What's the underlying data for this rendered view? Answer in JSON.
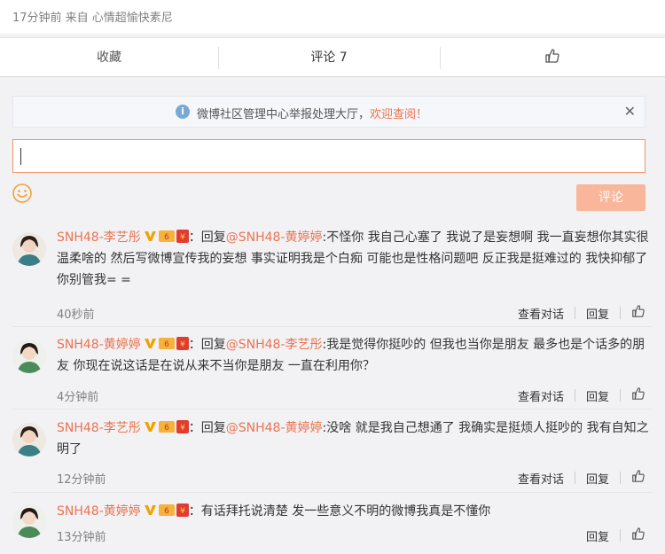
{
  "post": {
    "meta": "17分钟前 来自 心情超愉快素尼"
  },
  "tabs": [
    {
      "label": "收藏"
    },
    {
      "label": "评论 7"
    }
  ],
  "notice": {
    "text": "微博社区管理中心举报处理大厅，",
    "link": "欢迎查阅！"
  },
  "input": {
    "value": ""
  },
  "submit_label": "评论",
  "comments": [
    {
      "user": "SNH48-李艺彤",
      "prefix": "：回复",
      "mention": "@SNH48-黄婷婷",
      "text": ":不怪你 我自己心塞了 我说了是妄想啊 我一直妄想你其实很温柔啥的 然后写微博宣传我的妄想 事实证明我是个白痴 可能也是性格问题吧 反正我是挺难过的 我快抑郁了你别管我= =",
      "time": "40秒前",
      "view": "查看对话",
      "reply": "回复"
    },
    {
      "user": "SNH48-黄婷婷",
      "prefix": "：回复",
      "mention": "@SNH48-李艺彤",
      "text": ":我是觉得你挺吵的 但我也当你是朋友 最多也是个话多的朋友 你现在说这话是在说从来不当你是朋友 一直在利用你？",
      "time": "4分钟前",
      "view": "查看对话",
      "reply": "回复"
    },
    {
      "user": "SNH48-李艺彤",
      "prefix": "：回复",
      "mention": "@SNH48-黄婷婷",
      "text": ":没啥 就是我自己想通了 我确实是挺烦人挺吵的 我有自知之明了",
      "time": "12分钟前",
      "view": "查看对话",
      "reply": "回复"
    },
    {
      "user": "SNH48-黄婷婷",
      "prefix": "：",
      "mention": "",
      "text": "有话拜托说清楚 发一些意义不明的微博我真是不懂你",
      "time": "13分钟前",
      "reply": "回复"
    }
  ],
  "colors": {
    "accent": "#eb7350",
    "submit": "#f9b69b",
    "info": "#7aa8d4"
  }
}
